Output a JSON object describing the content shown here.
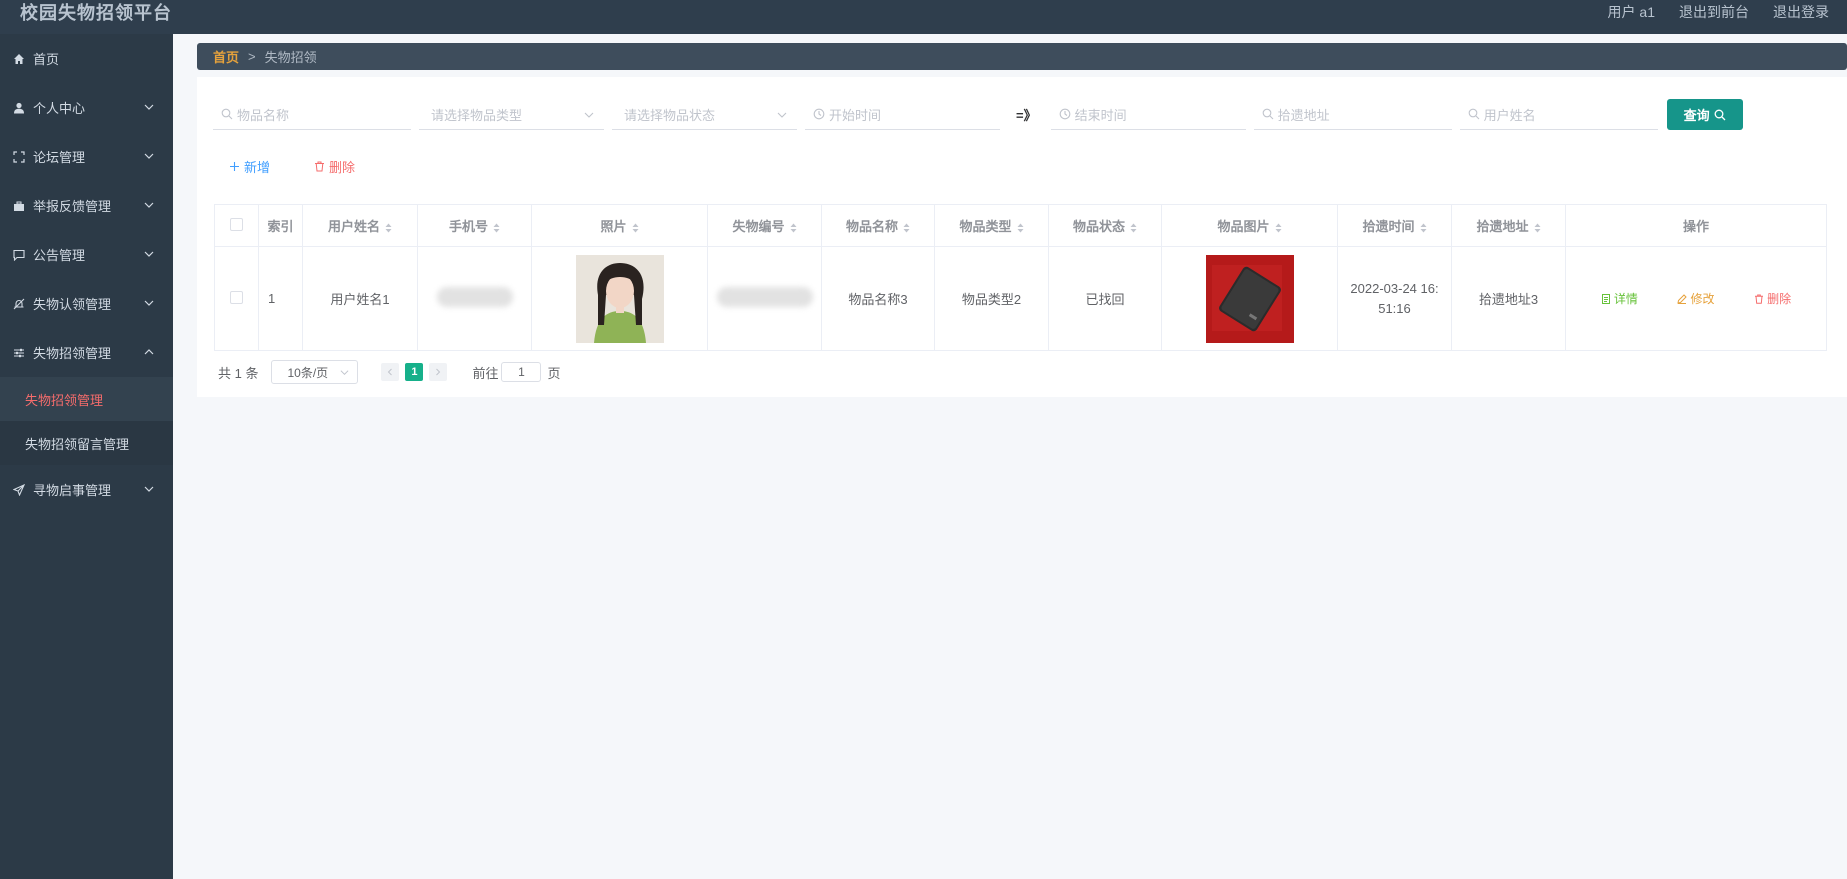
{
  "app": {
    "title": "校园失物招领平台"
  },
  "topbar": {
    "user": "用户 a1",
    "to_front": "退出到前台",
    "logout": "退出登录"
  },
  "sidebar": {
    "items": [
      {
        "label": "首页",
        "icon": "home-icon"
      },
      {
        "label": "个人中心",
        "icon": "user-icon"
      },
      {
        "label": "论坛管理",
        "icon": "fullscreen-icon"
      },
      {
        "label": "举报反馈管理",
        "icon": "briefcase-icon"
      },
      {
        "label": "公告管理",
        "icon": "message-icon"
      },
      {
        "label": "失物认领管理",
        "icon": "bell-off-icon"
      },
      {
        "label": "失物招领管理",
        "icon": "sliders-icon"
      },
      {
        "label": "寻物启事管理",
        "icon": "send-icon"
      }
    ],
    "submenu": [
      "失物招领管理",
      "失物招领留言管理"
    ]
  },
  "breadcrumb": {
    "home": "首页",
    "sep": ">",
    "current": "失物招领"
  },
  "filters": {
    "item_name": "物品名称",
    "item_type": "请选择物品类型",
    "item_status": "请选择物品状态",
    "start_time": "开始时间",
    "range_sep": "=》",
    "end_time": "结束时间",
    "address": "拾遗地址",
    "user_name": "用户姓名",
    "query_label": "查询"
  },
  "actions": {
    "add": "新增",
    "delete": "删除"
  },
  "table": {
    "headers": [
      "索引",
      "用户姓名",
      "手机号",
      "照片",
      "失物编号",
      "物品名称",
      "物品类型",
      "物品状态",
      "物品图片",
      "拾遗时间",
      "拾遗地址",
      "操作"
    ],
    "rows": [
      {
        "index": "1",
        "user_name": "用户姓名1",
        "item_name": "物品名称3",
        "item_type": "物品类型2",
        "item_status": "已找回",
        "time_line1": "2022-03-24 16:",
        "time_line2": "51:16",
        "address": "拾遗地址3",
        "op_detail": "详情",
        "op_edit": "修改",
        "op_delete": "删除"
      }
    ]
  },
  "pagination": {
    "total": "共 1 条",
    "page_size": "10条/页",
    "current_page": "1",
    "goto_label": "前往",
    "goto_value": "1",
    "page_suffix": "页"
  },
  "colors": {
    "accent": "#16958a",
    "danger": "#f56c6c",
    "warning": "#e6a23c",
    "success": "#67c23a",
    "primary": "#409eff"
  }
}
